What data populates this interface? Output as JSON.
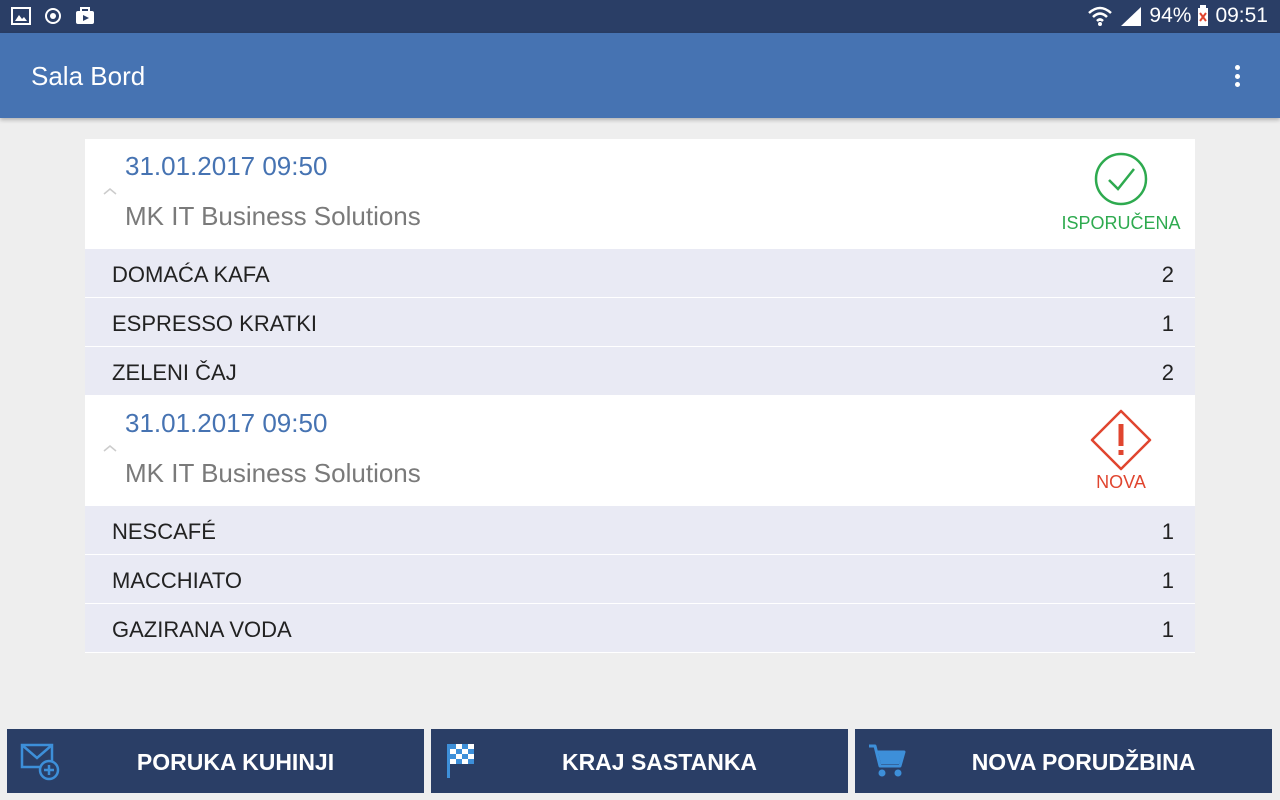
{
  "status_bar": {
    "battery": "94%",
    "time": "09:51",
    "left_icons": [
      "image-icon",
      "sync-icon",
      "briefcase-icon"
    ],
    "right_icons": [
      "wifi-icon",
      "signal-icon",
      "battery-icon"
    ]
  },
  "app_bar": {
    "title": "Sala Bord",
    "menu_icon": "more-vert-icon"
  },
  "orders": [
    {
      "datetime": "31.01.2017 09:50",
      "client": "MK IT Business Solutions",
      "status": "ISPORUČENA",
      "status_icon": "check-circle-icon",
      "status_color": "#2eaa4f",
      "items": [
        {
          "name": "DOMAĆA KAFA",
          "qty": "2"
        },
        {
          "name": "ESPRESSO KRATKI",
          "qty": "1"
        },
        {
          "name": "ZELENI ČAJ",
          "qty": "2"
        }
      ]
    },
    {
      "datetime": "31.01.2017 09:50",
      "client": "MK IT Business Solutions",
      "status": "NOVA",
      "status_icon": "alert-diamond-icon",
      "status_color": "#e0452f",
      "items": [
        {
          "name": "NESCAFÉ",
          "qty": "1"
        },
        {
          "name": "MACCHIATO",
          "qty": "1"
        },
        {
          "name": "GAZIRANA VODA",
          "qty": "1"
        }
      ]
    }
  ],
  "bottom_buttons": [
    {
      "label": "PORUKA KUHINJI",
      "icon": "mail-add-icon"
    },
    {
      "label": "KRAJ SASTANKA",
      "icon": "checkered-flag-icon"
    },
    {
      "label": "NOVA PORUDŽBINA",
      "icon": "cart-icon"
    }
  ],
  "colors": {
    "primary": "#4673b2",
    "dark": "#2a3e66",
    "icon_accent": "#3d8fd9"
  }
}
